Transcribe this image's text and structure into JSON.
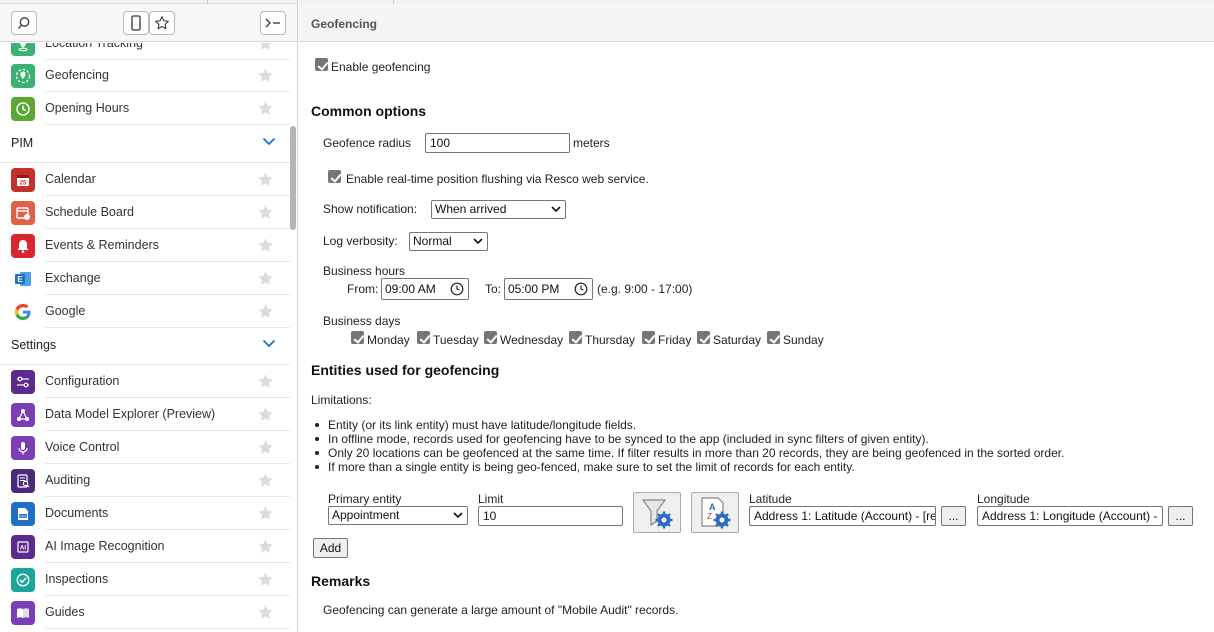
{
  "sidebar": {
    "items_top": [
      {
        "label": "Location Tracking",
        "icon": "location-tracking-icon",
        "color": "#3bb273"
      },
      {
        "label": "Geofencing",
        "icon": "geofencing-icon",
        "color": "#3bb273"
      },
      {
        "label": "Opening Hours",
        "icon": "clock-icon",
        "color": "#5aa832"
      }
    ],
    "section_pim": "PIM",
    "items_pim": [
      {
        "label": "Calendar",
        "icon": "calendar-icon",
        "color": "#c4302b"
      },
      {
        "label": "Schedule Board",
        "icon": "schedule-board-icon",
        "color": "#e0604a"
      },
      {
        "label": "Events & Reminders",
        "icon": "bell-icon",
        "color": "#d7282f"
      },
      {
        "label": "Exchange",
        "icon": "exchange-icon",
        "color": "#1f6fc5"
      },
      {
        "label": "Google",
        "icon": "google-icon",
        "color": "#ffffff"
      }
    ],
    "section_settings": "Settings",
    "items_settings": [
      {
        "label": "Configuration",
        "icon": "sliders-icon",
        "color": "#5b2a8c"
      },
      {
        "label": "Data Model Explorer (Preview)",
        "icon": "data-model-icon",
        "color": "#7a3fb5"
      },
      {
        "label": "Voice Control",
        "icon": "microphone-icon",
        "color": "#7a3fb5"
      },
      {
        "label": "Auditing",
        "icon": "auditing-icon",
        "color": "#4b2a7a"
      },
      {
        "label": "Documents",
        "icon": "documents-icon",
        "color": "#1f6fc5"
      },
      {
        "label": "AI Image Recognition",
        "icon": "ai-icon",
        "color": "#5b2a8c"
      },
      {
        "label": "Inspections",
        "icon": "inspections-icon",
        "color": "#1aa59a"
      },
      {
        "label": "Guides",
        "icon": "guides-icon",
        "color": "#7a3fb5"
      }
    ]
  },
  "main": {
    "title": "Geofencing",
    "enable_label": "Enable geofencing",
    "common_title": "Common options",
    "radius_label": "Geofence radius",
    "radius_value": "100",
    "radius_unit": "meters",
    "flush_label": "Enable real-time position flushing via Resco web service.",
    "notification_label": "Show notification:",
    "notification_value": "When arrived",
    "verbosity_label": "Log verbosity:",
    "verbosity_value": "Normal",
    "business_hours_label": "Business hours",
    "from_label": "From:",
    "from_value": "09:00  AM",
    "to_label": "To:",
    "to_value": "05:00  PM",
    "hours_hint": "(e.g. 9:00 - 17:00)",
    "business_days_label": "Business days",
    "days": [
      "Monday",
      "Tuesday",
      "Wednesday",
      "Thursday",
      "Friday",
      "Saturday",
      "Sunday"
    ],
    "entities_title": "Entities used for geofencing",
    "limitations_label": "Limitations:",
    "limitations": [
      "Entity (or its link entity) must have latitude/longitude fields.",
      "In offline mode, records used for geofencing have to be synced to the app (included in sync filters of given entity).",
      "Only 20 locations can be geofenced at the same time. If filter results in more than 20 records, they are being geofenced in the sorted order.",
      "If more than a single entity is being geo-fenced, make sure to set the limit of records for each entity."
    ],
    "primary_entity_label": "Primary entity",
    "primary_entity_value": "Appointment",
    "limit_label": "Limit",
    "limit_value": "10",
    "latitude_label": "Latitude",
    "latitude_value": "Address 1: Latitude (Account) - [re",
    "longitude_label": "Longitude",
    "longitude_value": "Address 1: Longitude (Account) -",
    "ellipsis": "...",
    "add_label": "Add",
    "remarks_title": "Remarks",
    "remarks_text": "Geofencing can generate a large amount of \"Mobile Audit\" records."
  }
}
